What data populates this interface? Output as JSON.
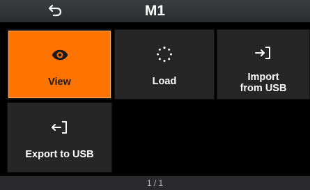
{
  "header": {
    "title": "M1",
    "back_icon": "back-arrow-icon"
  },
  "tiles": [
    {
      "label": "View",
      "icon": "eye-icon",
      "selected": true
    },
    {
      "label": "Load",
      "icon": "loading-dots-icon",
      "selected": false
    },
    {
      "label_line1": "Import",
      "label_line2": "from USB",
      "icon": "import-icon",
      "selected": false
    },
    {
      "label": "Export to USB",
      "icon": "export-icon",
      "selected": false
    }
  ],
  "footer": {
    "page_indicator": "1 / 1"
  },
  "colors": {
    "accent": "#ff7300",
    "tile": "#262626",
    "header": "#333539",
    "background": "#000000"
  }
}
